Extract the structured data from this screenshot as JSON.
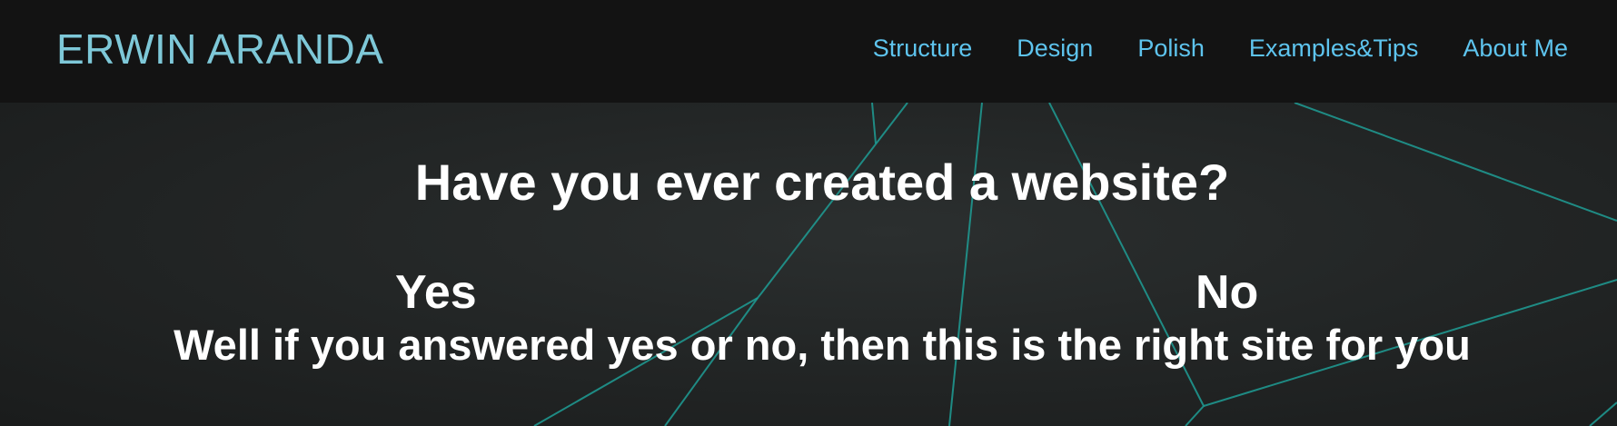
{
  "header": {
    "brand": "ERWIN ARANDA",
    "nav": [
      {
        "label": "Structure"
      },
      {
        "label": "Design"
      },
      {
        "label": "Polish"
      },
      {
        "label": "Examples&Tips"
      },
      {
        "label": "About Me"
      }
    ]
  },
  "hero": {
    "question": "Have you ever created a website?",
    "yes_label": "Yes",
    "no_label": "No",
    "tagline": "Well if you answered yes or no, then this is the right site for you"
  },
  "colors": {
    "navbar_bg": "#131313",
    "brand": "#7ec8d8",
    "nav_link": "#5ec4ee",
    "hero_lines": "#1f9e95",
    "hero_text": "#ffffff"
  }
}
